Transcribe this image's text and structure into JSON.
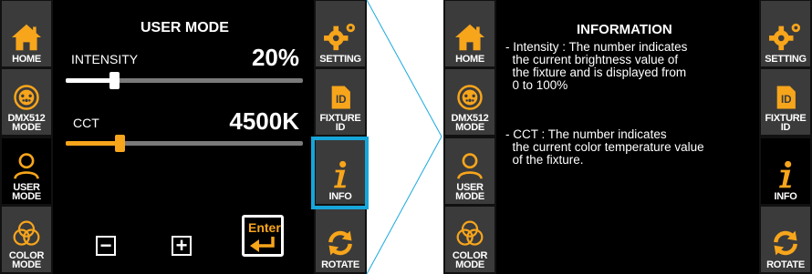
{
  "colors": {
    "accent": "#f7a51b",
    "highlight": "#17a6d9",
    "button_bg": "#3b3b3b",
    "arrow_line": "#1aa9e0"
  },
  "left_panel": {
    "nav": {
      "home": "HOME",
      "dmx": "DMX512\nMODE",
      "user": "USER\nMODE",
      "color": "COLOR\nMODE"
    },
    "right_nav": {
      "setting": "SETTING",
      "fixture": "FIXTURE\nID",
      "info": "INFO",
      "rotate": "ROTATE"
    },
    "title": "USER MODE",
    "intensity": {
      "label": "INTENSITY",
      "value": "20%",
      "level": 0.2
    },
    "cct": {
      "label": "CCT",
      "value": "4500K",
      "level": 0.22
    },
    "minus": "−",
    "plus": "+",
    "enter": "Enter"
  },
  "right_panel": {
    "nav": {
      "home": "HOME",
      "dmx": "DMX512\nMODE",
      "user": "USER\nMODE",
      "color": "COLOR\nMODE"
    },
    "right_nav": {
      "setting": "SETTING",
      "fixture": "FIXTURE\nID",
      "info": "INFO",
      "rotate": "ROTATE"
    },
    "title": "INFORMATION",
    "para1": "- Intensity : The number indicates\n  the current brightness value of\n  the fixture and is displayed from\n  0 to 100%",
    "para2": "- CCT : The number indicates\n  the current color temperature value\n  of the fixture."
  }
}
